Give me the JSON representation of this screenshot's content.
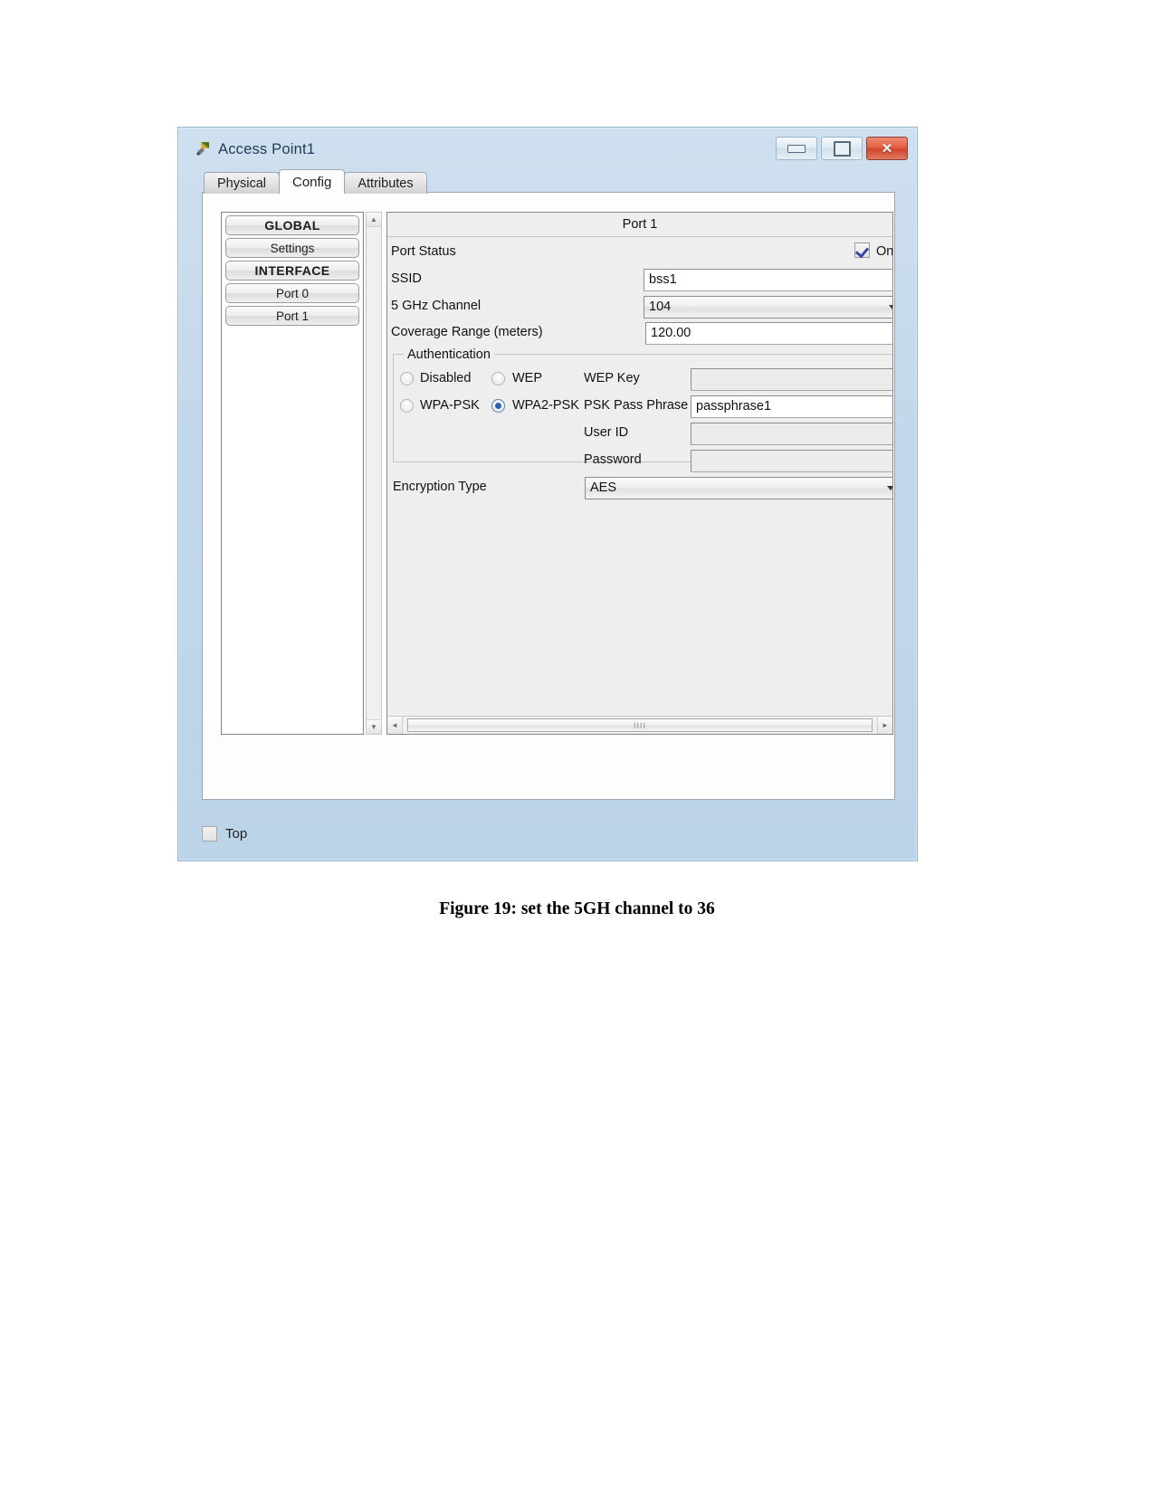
{
  "window": {
    "title": "Access Point1",
    "icon": "access-point-icon",
    "buttons": {
      "minimize": "minimize-icon",
      "maximize": "maximize-icon",
      "close": "✕"
    }
  },
  "tabs": [
    {
      "label": "Physical",
      "active": false
    },
    {
      "label": "Config",
      "active": true
    },
    {
      "label": "Attributes",
      "active": false
    }
  ],
  "sidebar": {
    "items": [
      {
        "label": "GLOBAL",
        "bold": true
      },
      {
        "label": "Settings",
        "bold": false
      },
      {
        "label": "INTERFACE",
        "bold": true
      },
      {
        "label": "Port 0",
        "bold": false
      },
      {
        "label": "Port 1",
        "bold": false
      }
    ],
    "scroll_up": "▲",
    "scroll_down": "▼"
  },
  "port_panel": {
    "header": "Port 1",
    "port_status": {
      "label": "Port Status",
      "checkbox_checked": true,
      "value_label": "On"
    },
    "ssid": {
      "label": "SSID",
      "value": "bss1"
    },
    "channel": {
      "label": "5 GHz Channel",
      "value": "104"
    },
    "coverage": {
      "label": "Coverage Range (meters)",
      "value": "120.00"
    },
    "authentication": {
      "title": "Authentication",
      "options": [
        {
          "label": "Disabled",
          "selected": false
        },
        {
          "label": "WEP",
          "selected": false
        },
        {
          "label": "WPA-PSK",
          "selected": false
        },
        {
          "label": "WPA2-PSK",
          "selected": true
        }
      ],
      "fields": [
        {
          "label": "WEP Key",
          "value": "",
          "enabled": false
        },
        {
          "label": "PSK Pass Phrase",
          "value": "passphrase1",
          "enabled": true
        },
        {
          "label": "User ID",
          "value": "",
          "enabled": false
        },
        {
          "label": "Password",
          "value": "",
          "enabled": false
        }
      ]
    },
    "encryption": {
      "label": "Encryption Type",
      "value": "AES"
    },
    "hscroll": {
      "left_arrow": "◄",
      "right_arrow": "►",
      "grip": "IIII"
    }
  },
  "bottom": {
    "checkbox_label": "Top",
    "checkbox_checked": false
  },
  "figure_caption": "Figure 19: set the 5GH channel to 36"
}
